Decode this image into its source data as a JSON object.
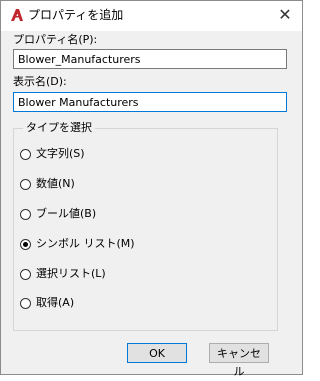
{
  "window": {
    "title": "プロパティを追加",
    "close_glyph": "✕",
    "app_icon": "autocad-icon",
    "icon_color": "#c1272d"
  },
  "property_name": {
    "label": "プロパティ名(P):",
    "value": "Blower_Manufacturers"
  },
  "display_name": {
    "label": "表示名(D):",
    "value": "Blower Manufacturers"
  },
  "type_group": {
    "title": "タイプを選択",
    "options": [
      {
        "label": "文字列(S)",
        "checked": false
      },
      {
        "label": "数値(N)",
        "checked": false
      },
      {
        "label": "ブール値(B)",
        "checked": false
      },
      {
        "label": "シンボル リスト(M)",
        "checked": true
      },
      {
        "label": "選択リスト(L)",
        "checked": false
      },
      {
        "label": "取得(A)",
        "checked": false
      }
    ]
  },
  "buttons": {
    "ok_label": "OK",
    "cancel_label": "キャンセル"
  }
}
